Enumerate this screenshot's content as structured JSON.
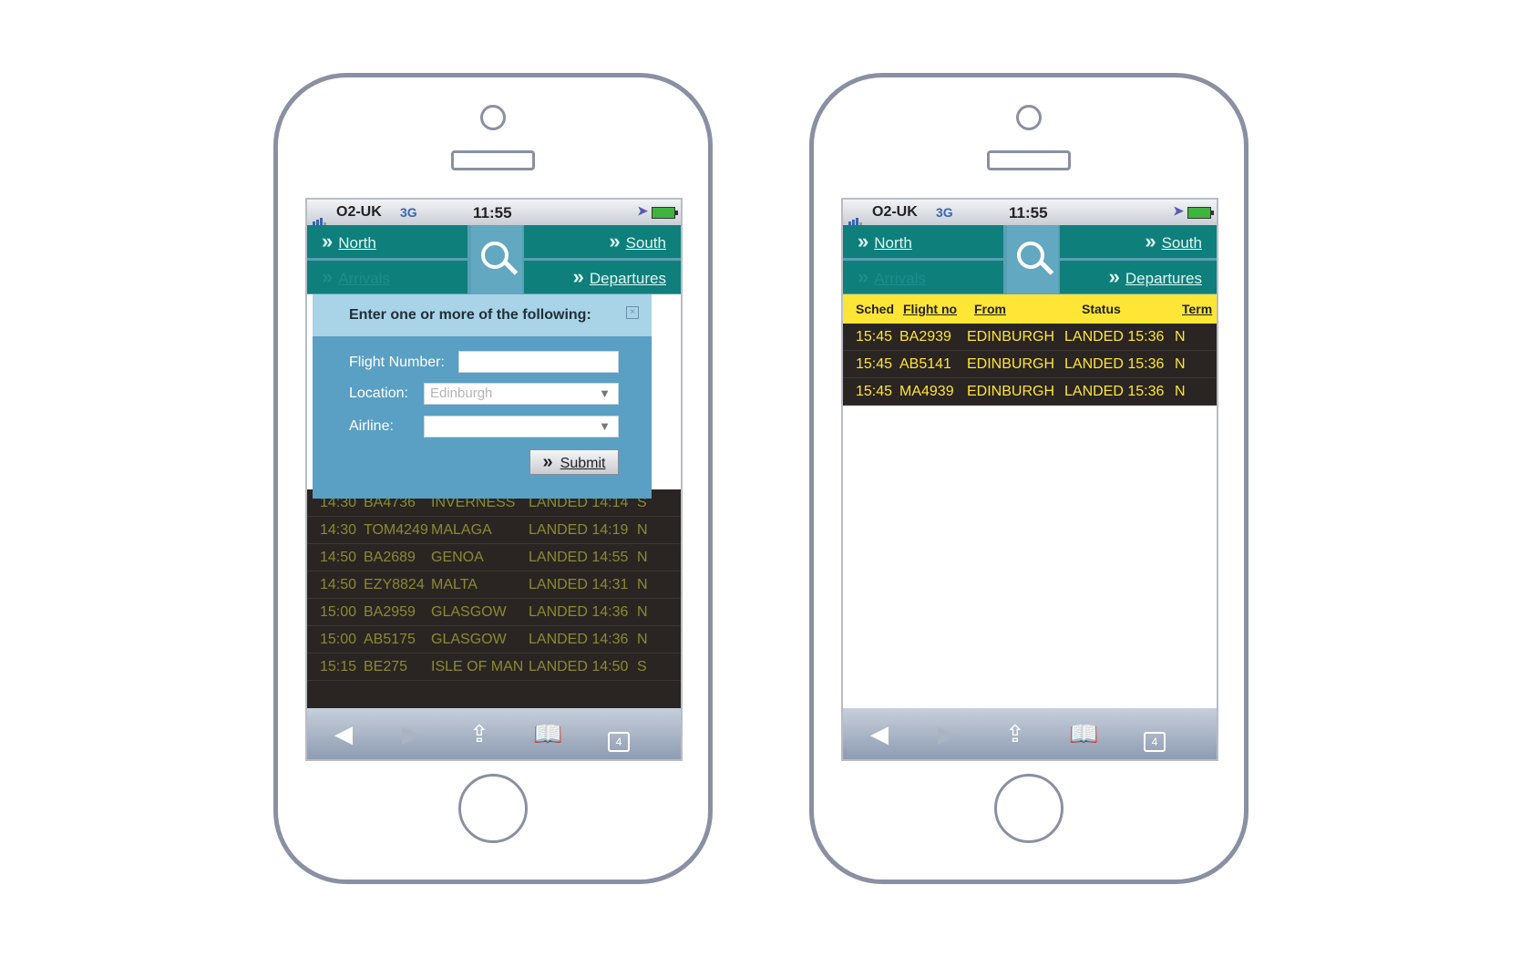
{
  "status": {
    "carrier": "O2-UK",
    "network": "3G",
    "time": "11:55"
  },
  "nav": {
    "north": "North",
    "south": "South",
    "arrivals": "Arrivals",
    "departures": "Departures"
  },
  "search_modal": {
    "title": "Enter one or more of the following:",
    "close": "×",
    "flight_number_label": "Flight Number:",
    "location_label": "Location:",
    "location_value": "Edinburgh",
    "airline_label": "Airline:",
    "airline_value": "",
    "submit": "Submit"
  },
  "left_flights": [
    {
      "sched": "14:30",
      "flight": "BA4736",
      "from": "INVERNESS",
      "status": "LANDED 14:14",
      "term": "S"
    },
    {
      "sched": "14:30",
      "flight": "TOM4249",
      "from": "MALAGA",
      "status": "LANDED 14:19",
      "term": "N"
    },
    {
      "sched": "14:50",
      "flight": "BA2689",
      "from": "GENOA",
      "status": "LANDED 14:55",
      "term": "N"
    },
    {
      "sched": "14:50",
      "flight": "EZY8824",
      "from": "MALTA",
      "status": "LANDED 14:31",
      "term": "N"
    },
    {
      "sched": "15:00",
      "flight": "BA2959",
      "from": "GLASGOW",
      "status": "LANDED 14:36",
      "term": "N"
    },
    {
      "sched": "15:00",
      "flight": "AB5175",
      "from": "GLASGOW",
      "status": "LANDED 14:36",
      "term": "N"
    },
    {
      "sched": "15:15",
      "flight": "BE275",
      "from": "ISLE OF MAN",
      "status": "LANDED 14:50",
      "term": "S"
    }
  ],
  "results": {
    "headers": {
      "sched": "Sched",
      "flight": "Flight no",
      "from": "From",
      "status": "Status",
      "term": "Term"
    },
    "rows": [
      {
        "sched": "15:45",
        "flight": "BA2939",
        "from": "EDINBURGH",
        "status": "LANDED 15:36",
        "term": "N"
      },
      {
        "sched": "15:45",
        "flight": "AB5141",
        "from": "EDINBURGH",
        "status": "LANDED 15:36",
        "term": "N"
      },
      {
        "sched": "15:45",
        "flight": "MA4939",
        "from": "EDINBURGH",
        "status": "LANDED 15:36",
        "term": "N"
      }
    ]
  },
  "toolbar": {
    "tabs_count": "4"
  }
}
